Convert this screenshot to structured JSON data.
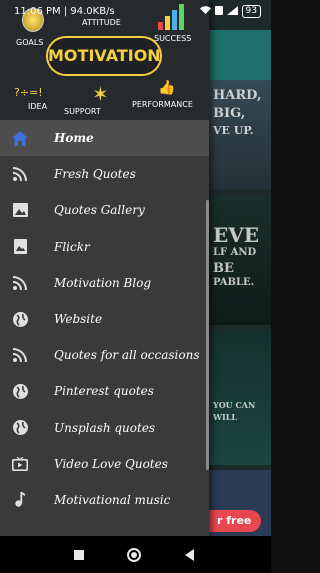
{
  "status_bar": {
    "time": "11:06 PM | 94.0KB/s",
    "battery": "93"
  },
  "header": {
    "words": {
      "goals": "GOALS",
      "attitude": "ATTITUDE",
      "success": "SUCCESS",
      "motivation": "MOTIVATION",
      "idea": "IDEA",
      "support": "SUPPORT",
      "performance": "PERFORMANCE"
    }
  },
  "menu": {
    "items": [
      {
        "label": "Home",
        "icon": "home-icon",
        "active": true
      },
      {
        "label": "Fresh Quotes",
        "icon": "rss-icon"
      },
      {
        "label": "Quotes Gallery",
        "icon": "image-icon"
      },
      {
        "label": "Flickr",
        "icon": "portrait-image-icon"
      },
      {
        "label": "Motivation Blog",
        "icon": "rss-icon"
      },
      {
        "label": "Website",
        "icon": "globe-icon"
      },
      {
        "label": "Quotes for all occasions",
        "icon": "rss-icon"
      },
      {
        "label": "Pinterest quotes",
        "icon": "globe-icon"
      },
      {
        "label": "Unsplash quotes",
        "icon": "globe-icon"
      },
      {
        "label": "Video Love Quotes",
        "icon": "tv-icon"
      },
      {
        "label": "Motivational music",
        "icon": "music-note-icon"
      }
    ]
  },
  "background": {
    "card1": [
      "HARD,",
      "BIG,",
      "VE UP."
    ],
    "card2": [
      "EVE",
      "LF AND",
      "BE",
      "PABLE."
    ],
    "card3": [
      "YOU CAN",
      "WILL"
    ],
    "button": "r free"
  },
  "colors": {
    "drawer_bg": "#3a3a3a",
    "active_item_bg": "#4d4d4d",
    "accent_home": "#3f6fd8",
    "cta": "#e8474f"
  }
}
